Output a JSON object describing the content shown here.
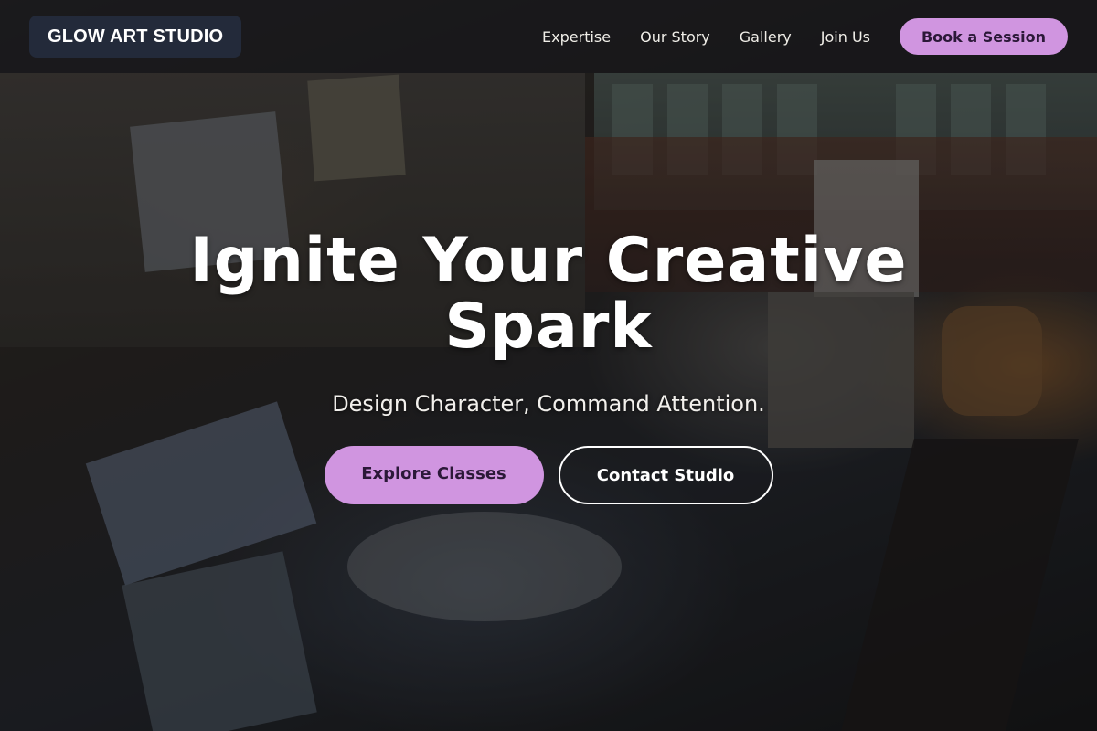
{
  "navbar": {
    "logo": "GLOW ART STUDIO",
    "links": [
      "Expertise",
      "Our Story",
      "Gallery",
      "Join Us"
    ],
    "cta": "Book a Session"
  },
  "hero": {
    "title": "Ignite Your Creative Spark",
    "subtitle": "Design Character, Command Attention.",
    "primary_cta": "Explore Classes",
    "secondary_cta": "Contact Studio"
  },
  "colors": {
    "accent": "#d095e0",
    "logo_bg": "#232a3a",
    "text": "#ffffff"
  }
}
